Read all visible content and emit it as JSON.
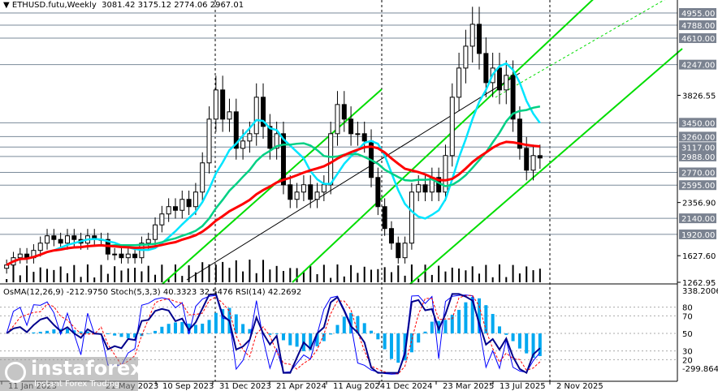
{
  "header": {
    "symbol": "ETHUSD.futu,Weekly",
    "ohlc": "3081.42 3175.12 2774.06 2967.01"
  },
  "indicator": {
    "label": "OsMA(12,26,9) -212.9750  Stoch(5,3,3) 40.3323 32.5476  RSI(14) 42.2692"
  },
  "watermark": {
    "brand": "instaforex",
    "tagline": "Instant Forex Trading"
  },
  "colors": {
    "fast_ma": "#00e5ff",
    "mid_ma": "#00d084",
    "slow_ma": "#ff0000",
    "channel": "#00dd00",
    "candle": "#000000",
    "osma": "#00a8f0",
    "stoch_main": "#0000ff",
    "stoch_signal": "#ff0000",
    "rsi": "#00008b"
  },
  "chart_data": {
    "type": "candlestick",
    "timeframe": "Weekly",
    "ylim": [
      1262.95,
      4955
    ],
    "price_ticks": [
      "3826.55",
      "2356.90",
      "1627.60",
      "1262.95"
    ],
    "level_labels": [
      "4955.00",
      "4788.00",
      "4610.00",
      "4247.00",
      "3450.00",
      "3260.00",
      "3117.00",
      "2988.00",
      "2770.00",
      "2595.00",
      "2140.00",
      "1920.00"
    ],
    "x_ticks": [
      "11 Jan 2023",
      "21 May 2023",
      "10 Sep 2023",
      "31 Dec 2023",
      "21 Apr 2024",
      "11 Aug 2024",
      "1 Dec 2024",
      "23 Mar 2025",
      "13 Jul 2025",
      "2 Nov 2025"
    ],
    "closes": [
      1500,
      1600,
      1650,
      1600,
      1700,
      1800,
      1900,
      1850,
      1800,
      1900,
      1850,
      1800,
      1900,
      1850,
      1850,
      1650,
      1650,
      1600,
      1650,
      1600,
      1800,
      1850,
      2050,
      2200,
      2300,
      2250,
      2400,
      2300,
      2500,
      2900,
      3500,
      3900,
      3500,
      3600,
      3100,
      3200,
      3300,
      3800,
      3400,
      3100,
      3300,
      2600,
      2400,
      2500,
      2600,
      2400,
      2500,
      2600,
      3300,
      3700,
      3500,
      3300,
      3300,
      3200,
      2700,
      2300,
      2000,
      1800,
      1600,
      1800,
      2500,
      2600,
      2500,
      2700,
      2500,
      3000,
      3800,
      4200,
      4500,
      4800,
      4400,
      4000,
      4200,
      3900,
      4100,
      3500,
      3100,
      2800,
      3000,
      2967.01
    ],
    "osc_panel": {
      "ylim": [
        -299.8649,
        338.2006
      ],
      "ticks": [
        "338.2006",
        "80",
        "70",
        "50",
        "30",
        "20",
        "-299.8649"
      ]
    }
  }
}
